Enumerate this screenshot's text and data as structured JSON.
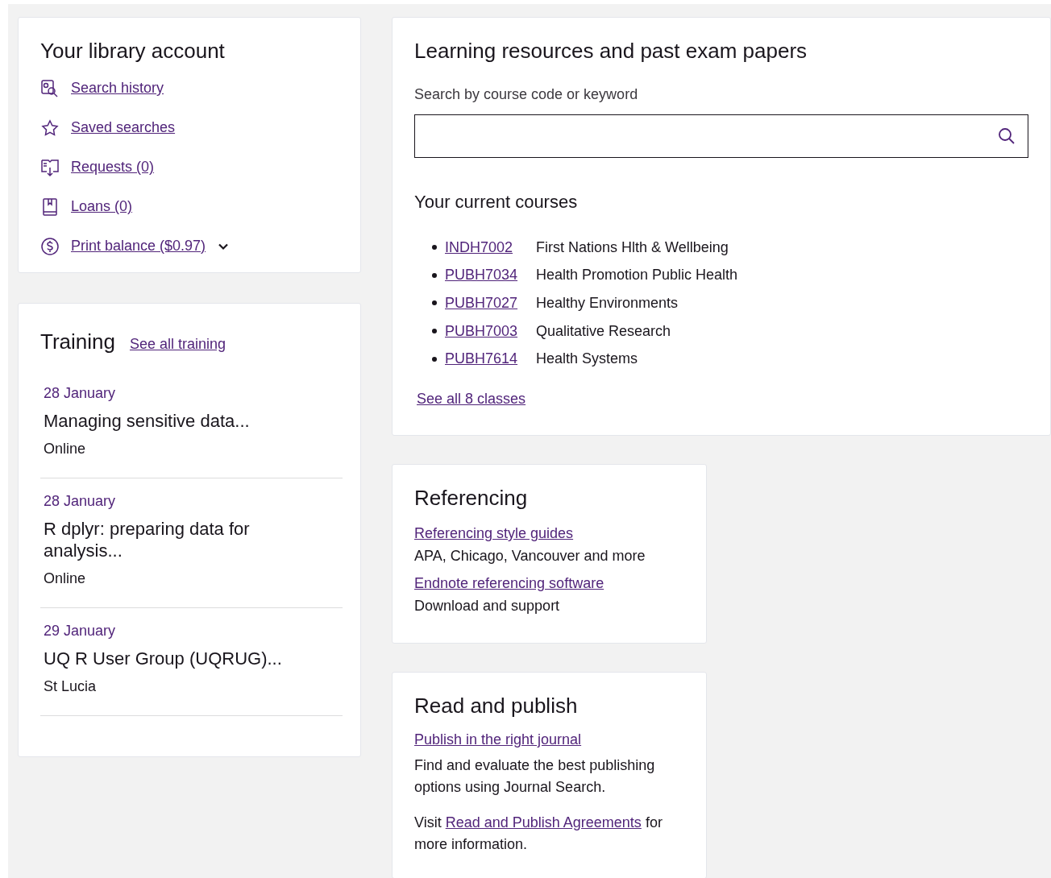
{
  "account": {
    "title": "Your library account",
    "items": [
      {
        "kind": "history",
        "label": "Search history"
      },
      {
        "kind": "star",
        "label": "Saved searches"
      },
      {
        "kind": "requests",
        "label": "Requests (0)"
      },
      {
        "kind": "loans",
        "label": "Loans (0)"
      },
      {
        "kind": "balance",
        "label": "Print balance ($0.97)",
        "expanded": false
      }
    ]
  },
  "training": {
    "title": "Training",
    "link": "See all training",
    "events": [
      {
        "date": "28 January",
        "title": "Managing sensitive data...",
        "location": "Online"
      },
      {
        "date": "28 January",
        "title": "R dplyr: preparing data for analysis...",
        "location": "Online"
      },
      {
        "date": "29 January",
        "title": "UQ R User Group (UQRUG)...",
        "location": "St Lucia"
      }
    ]
  },
  "learning": {
    "title": "Learning resources and past exam papers",
    "search_label": "Search by course code or keyword",
    "courses_title": "Your current courses",
    "courses": [
      {
        "code": "INDH7002",
        "name": "First Nations Hlth & Wellbeing"
      },
      {
        "code": "PUBH7034",
        "name": "Health Promotion Public Health"
      },
      {
        "code": "PUBH7027",
        "name": "Healthy Environments"
      },
      {
        "code": "PUBH7003",
        "name": "Qualitative Research"
      },
      {
        "code": "PUBH7614",
        "name": "Health Systems"
      }
    ],
    "see_all": "See all 8 classes"
  },
  "referencing": {
    "title": "Referencing",
    "items": [
      {
        "link": "Referencing style guides",
        "text": "APA, Chicago, Vancouver and more"
      },
      {
        "link": "Endnote referencing software",
        "text": "Download and support"
      }
    ]
  },
  "publish": {
    "title": "Read and publish",
    "link": "Publish in the right journal",
    "text": "Find and evaluate the best publishing options using Journal Search.",
    "visit": {
      "before": "Visit",
      "link": "Read and Publish Agreements",
      "after": "for more information."
    }
  }
}
